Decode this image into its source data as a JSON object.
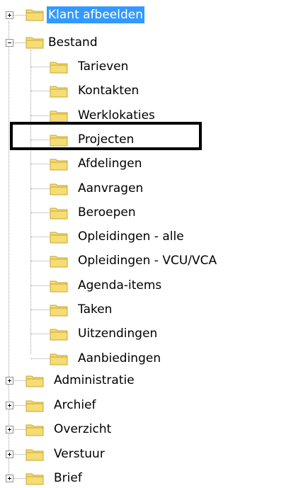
{
  "tree": {
    "root": {
      "label": "Klant afbeelden"
    },
    "bestand": {
      "label": "Bestand",
      "children": [
        "Tarieven",
        "Kontakten",
        "Werklokaties",
        "Projecten",
        "Afdelingen",
        "Aanvragen",
        "Beroepen",
        "Opleidingen - alle",
        "Opleidingen - VCU/VCA",
        "Agenda-items",
        "Taken",
        "Uitzendingen",
        "Aanbiedingen"
      ]
    },
    "others": [
      "Administratie",
      "Archief",
      "Overzicht",
      "Verstuur",
      "Brief"
    ]
  },
  "colors": {
    "selection": "#3399ff",
    "folder_fill": "#f5dc73",
    "folder_dark": "#c9a634"
  },
  "icons": {
    "folder": "folder-icon",
    "expand": "plus-expander-icon",
    "collapse": "minus-expander-icon"
  }
}
